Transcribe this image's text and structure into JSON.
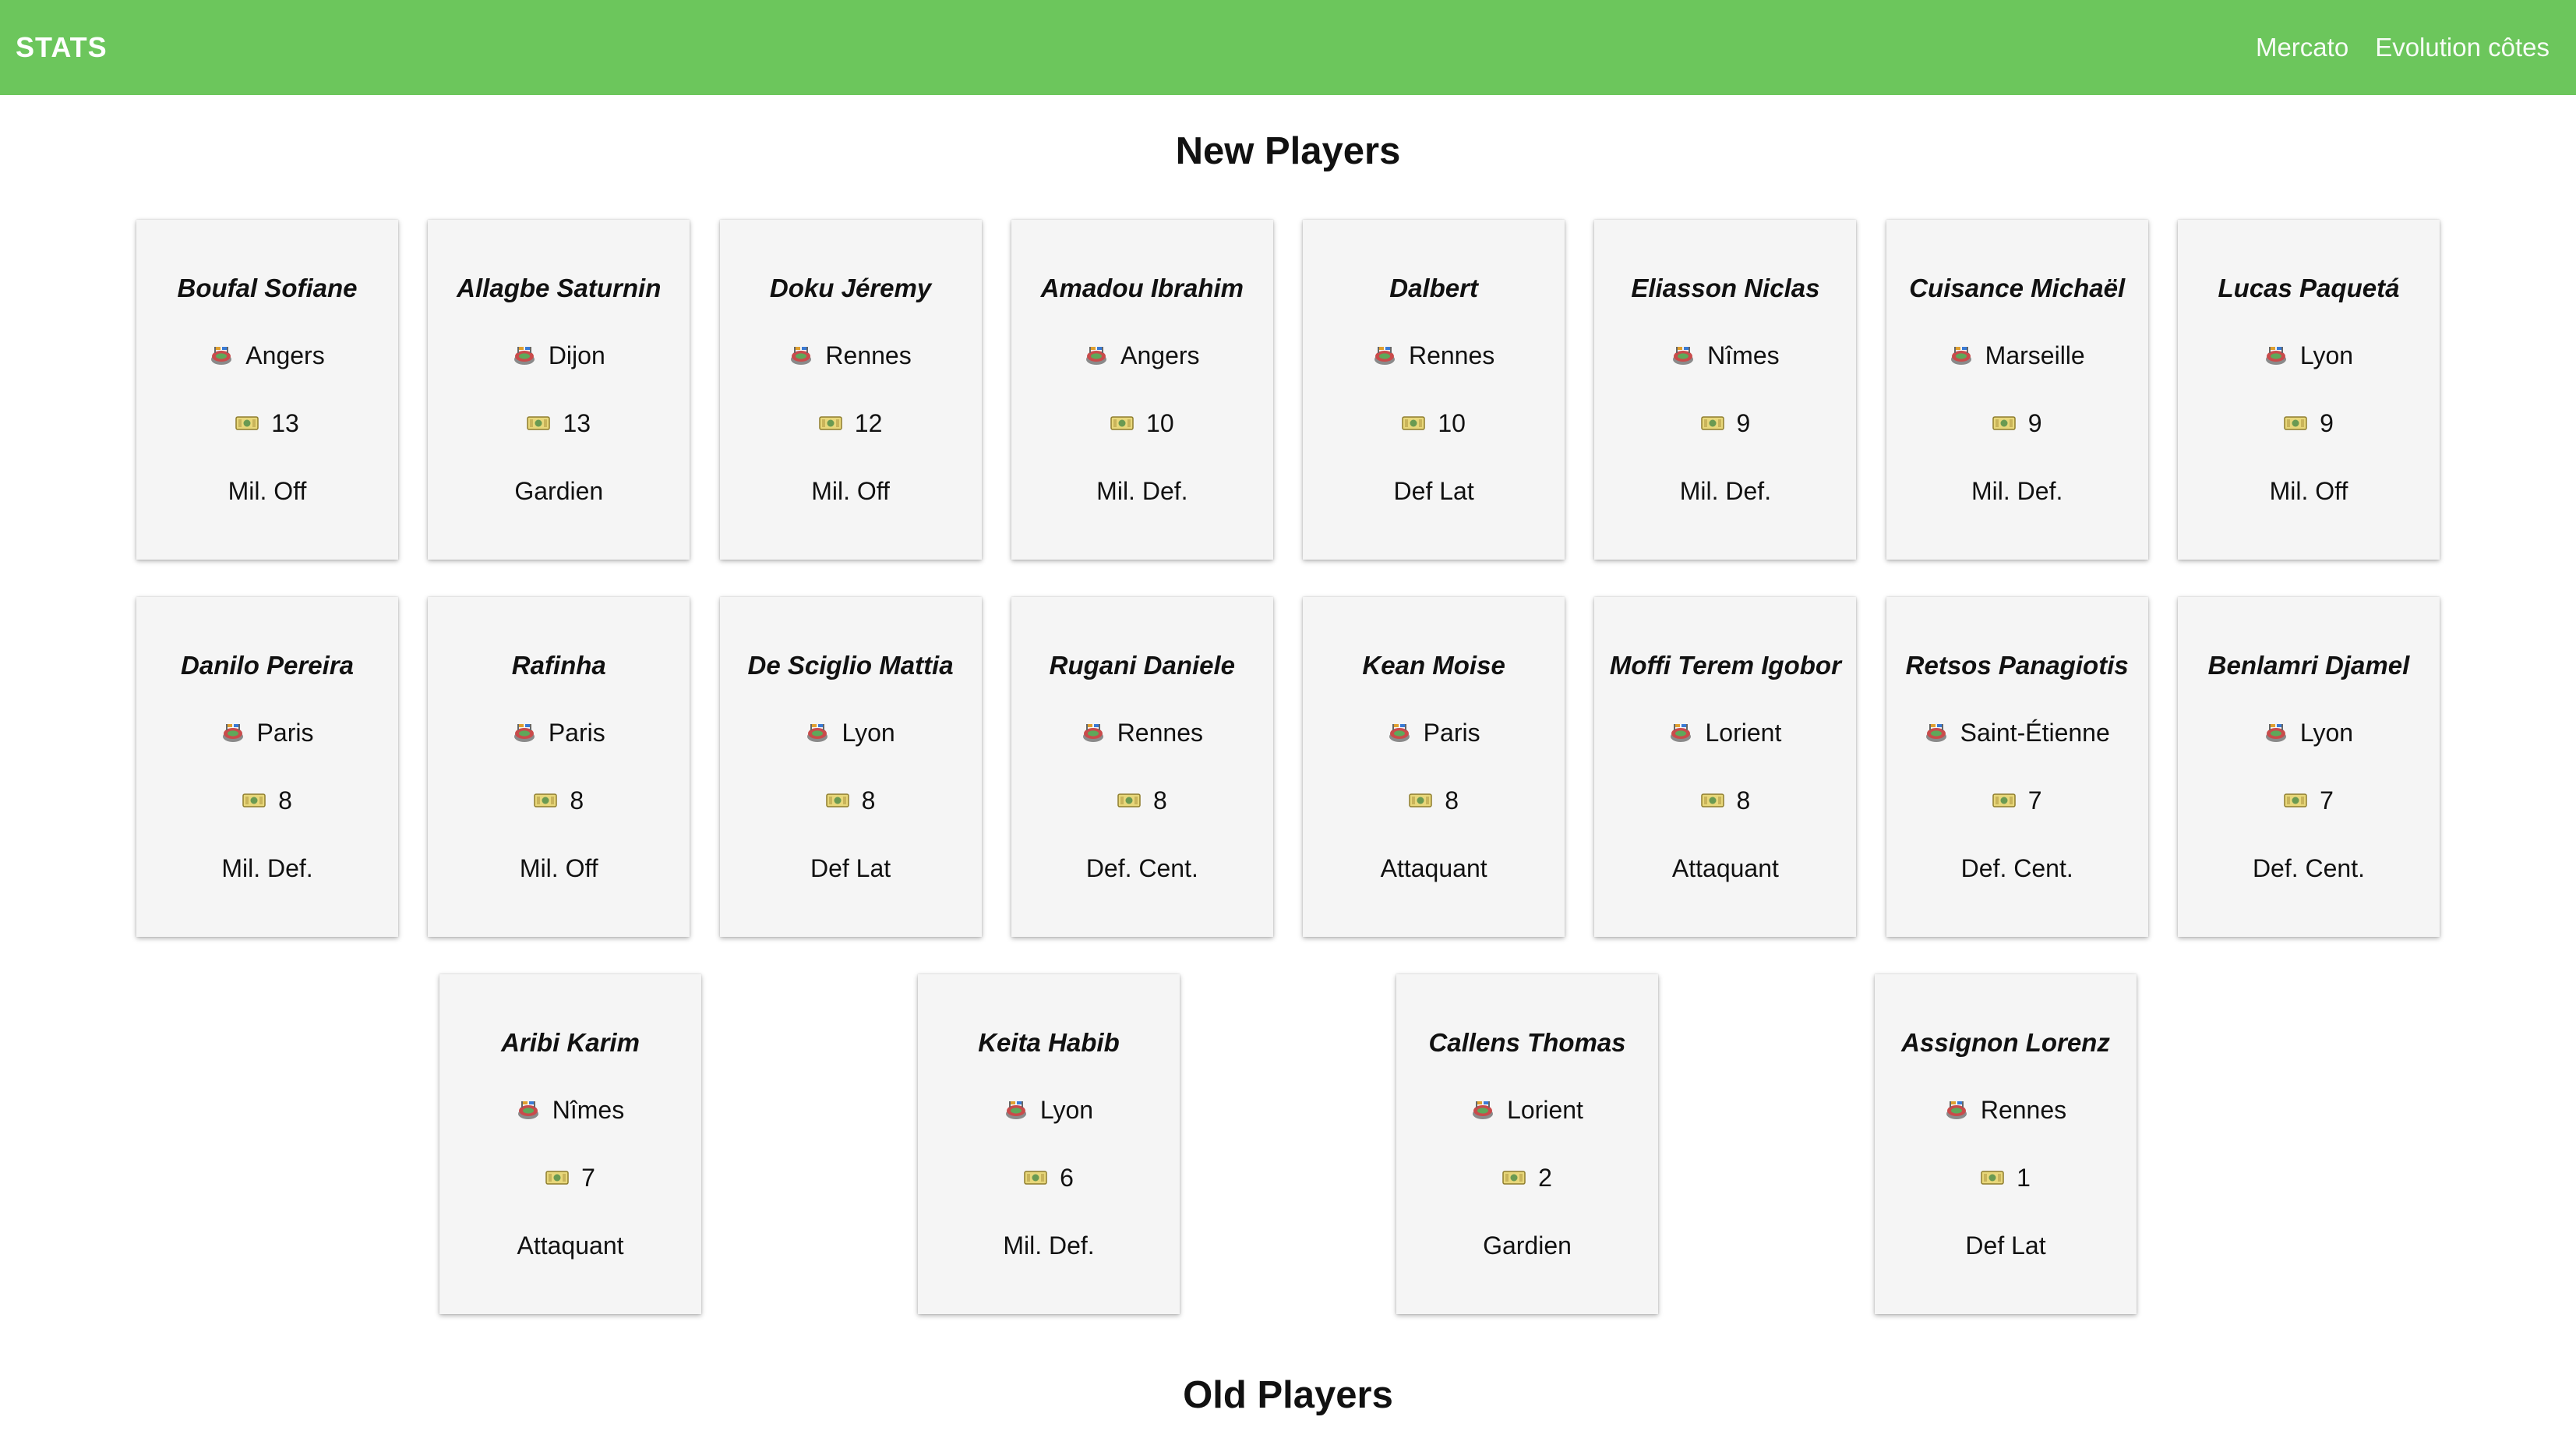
{
  "nav": {
    "brand": "STATS",
    "links": [
      "Mercato",
      "Evolution côtes"
    ]
  },
  "sections": {
    "new_title": "New Players",
    "old_title": "Old Players"
  },
  "icons": {
    "club": "stadium-icon",
    "price": "banknote-icon"
  },
  "colors": {
    "navbar": "#6cc65c",
    "card_bg": "#f5f5f5"
  },
  "new_players": [
    {
      "name": "Boufal Sofiane",
      "club": "Angers",
      "price": "13",
      "position": "Mil. Off"
    },
    {
      "name": "Allagbe Saturnin",
      "club": "Dijon",
      "price": "13",
      "position": "Gardien"
    },
    {
      "name": "Doku Jéremy",
      "club": "Rennes",
      "price": "12",
      "position": "Mil. Off"
    },
    {
      "name": "Amadou Ibrahim",
      "club": "Angers",
      "price": "10",
      "position": "Mil. Def."
    },
    {
      "name": "Dalbert",
      "club": "Rennes",
      "price": "10",
      "position": "Def Lat"
    },
    {
      "name": "Eliasson Niclas",
      "club": "Nîmes",
      "price": "9",
      "position": "Mil. Def."
    },
    {
      "name": "Cuisance Michaël",
      "club": "Marseille",
      "price": "9",
      "position": "Mil. Def."
    },
    {
      "name": "Lucas Paquetá",
      "club": "Lyon",
      "price": "9",
      "position": "Mil. Off"
    },
    {
      "name": "Danilo Pereira",
      "club": "Paris",
      "price": "8",
      "position": "Mil. Def."
    },
    {
      "name": "Rafinha",
      "club": "Paris",
      "price": "8",
      "position": "Mil. Off"
    },
    {
      "name": "De Sciglio Mattia",
      "club": "Lyon",
      "price": "8",
      "position": "Def Lat"
    },
    {
      "name": "Rugani Daniele",
      "club": "Rennes",
      "price": "8",
      "position": "Def. Cent."
    },
    {
      "name": "Kean Moise",
      "club": "Paris",
      "price": "8",
      "position": "Attaquant"
    },
    {
      "name": "Moffi Terem Igobor",
      "club": "Lorient",
      "price": "8",
      "position": "Attaquant"
    },
    {
      "name": "Retsos Panagiotis",
      "club": "Saint-Étienne",
      "price": "7",
      "position": "Def. Cent."
    },
    {
      "name": "Benlamri Djamel",
      "club": "Lyon",
      "price": "7",
      "position": "Def. Cent."
    },
    {
      "name": "Aribi Karim",
      "club": "Nîmes",
      "price": "7",
      "position": "Attaquant"
    },
    {
      "name": "Keita Habib",
      "club": "Lyon",
      "price": "6",
      "position": "Mil. Def."
    },
    {
      "name": "Callens Thomas",
      "club": "Lorient",
      "price": "2",
      "position": "Gardien"
    },
    {
      "name": "Assignon Lorenz",
      "club": "Rennes",
      "price": "1",
      "position": "Def Lat"
    }
  ]
}
